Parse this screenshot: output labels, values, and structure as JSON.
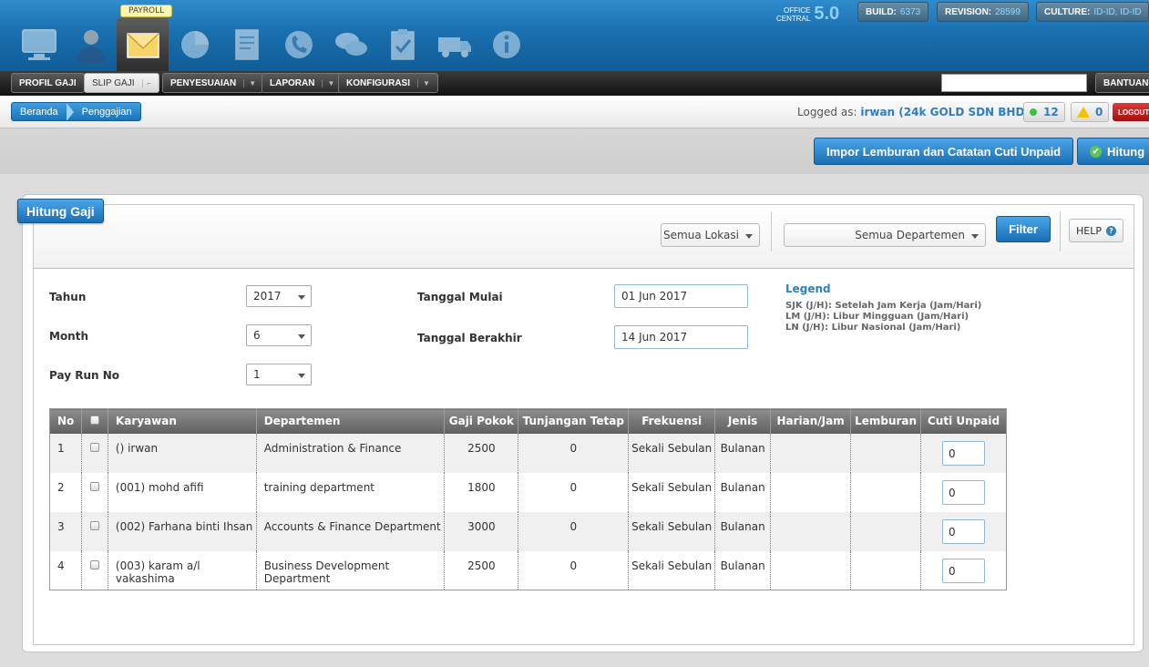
{
  "header": {
    "tooltip": "PAYROLL",
    "apps": [
      "monitor-icon",
      "user-icon",
      "envelope-icon",
      "pie-chart-icon",
      "document-icon",
      "phone-icon",
      "chat-icon",
      "clipboard-icon",
      "truck-icon",
      "info-icon"
    ],
    "office_line1": "OFFICE",
    "office_line2": "CENTRAL",
    "office_version": "5.0",
    "build_label": "BUILD:",
    "build_value": "6373",
    "revision_label": "REVISION:",
    "revision_value": "28599",
    "culture_label": "CULTURE:",
    "culture_value": "ID-ID, ID-ID"
  },
  "menu": {
    "profil": "PROFIL GAJI",
    "slip": "SLIP GAJI",
    "penyesuaian": "PENYESUAIAN",
    "laporan": "LAPORAN",
    "konfigurasi": "KONFIGURASI",
    "bantuan": "BANTUAN",
    "search_value": ""
  },
  "breadcrumb": {
    "home": "Beranda",
    "current": "Penggajian"
  },
  "user": {
    "logged_prefix": "Logged as:",
    "logged_name": "irwan (24k GOLD SDN BHD)",
    "online_count": "12",
    "warning_count": "0",
    "logout": "LOGOUT"
  },
  "actions": {
    "import": "Impor Lemburan dan Catatan Cuti Unpaid",
    "hitung": "Hitung"
  },
  "panel": {
    "title": "Hitung Gaji",
    "lokasi": "Semua Lokasi",
    "departemen": "Semua Departemen",
    "filter": "Filter",
    "help": "HELP"
  },
  "form": {
    "tahun_label": "Tahun",
    "tahun": "2017",
    "month_label": "Month",
    "month": "6",
    "payrun_label": "Pay Run No",
    "payrun": "1",
    "mulai_label": "Tanggal Mulai",
    "mulai": "01 Jun 2017",
    "berakhir_label": "Tanggal Berakhir",
    "berakhir": "14 Jun 2017"
  },
  "legend": {
    "title": "Legend",
    "sjk": "SJK (J/H): Setelah Jam Kerja (Jam/Hari)",
    "lm": "LM (J/H): Libur Mingguan (Jam/Hari)",
    "ln": "LN (J/H): Libur Nasional (Jam/Hari)"
  },
  "table": {
    "headers": {
      "no": "No",
      "karyawan": "Karyawan",
      "departemen": "Departemen",
      "gaji": "Gaji Pokok",
      "tunjangan": "Tunjangan Tetap",
      "frekuensi": "Frekuensi",
      "jenis": "Jenis",
      "harian": "Harian/Jam",
      "lemburan": "Lemburan",
      "cuti": "Cuti Unpaid"
    },
    "rows": [
      {
        "no": "1",
        "karyawan": "() irwan",
        "departemen": "Administration & Finance",
        "gaji": "2500",
        "tunjangan": "0",
        "frekuensi": "Sekali Sebulan",
        "jenis": "Bulanan",
        "harian": "",
        "lemburan": "",
        "cuti": "0"
      },
      {
        "no": "2",
        "karyawan": "(001) mohd afifi",
        "departemen": "training department",
        "gaji": "1800",
        "tunjangan": "0",
        "frekuensi": "Sekali Sebulan",
        "jenis": "Bulanan",
        "harian": "",
        "lemburan": "",
        "cuti": "0"
      },
      {
        "no": "3",
        "karyawan": "(002) Farhana binti Ihsan",
        "departemen": "Accounts & Finance Department",
        "gaji": "3000",
        "tunjangan": "0",
        "frekuensi": "Sekali Sebulan",
        "jenis": "Bulanan",
        "harian": "",
        "lemburan": "",
        "cuti": "0"
      },
      {
        "no": "4",
        "karyawan": "(003) karam a/l vakashima",
        "departemen": "Business Development Department",
        "gaji": "2500",
        "tunjangan": "0",
        "frekuensi": "Sekali Sebulan",
        "jenis": "Bulanan",
        "harian": "",
        "lemburan": "",
        "cuti": "0"
      }
    ]
  },
  "colors": {
    "accent": "#1a74b8",
    "header_bg": "#1a6fae",
    "logout": "#c21f1f"
  }
}
